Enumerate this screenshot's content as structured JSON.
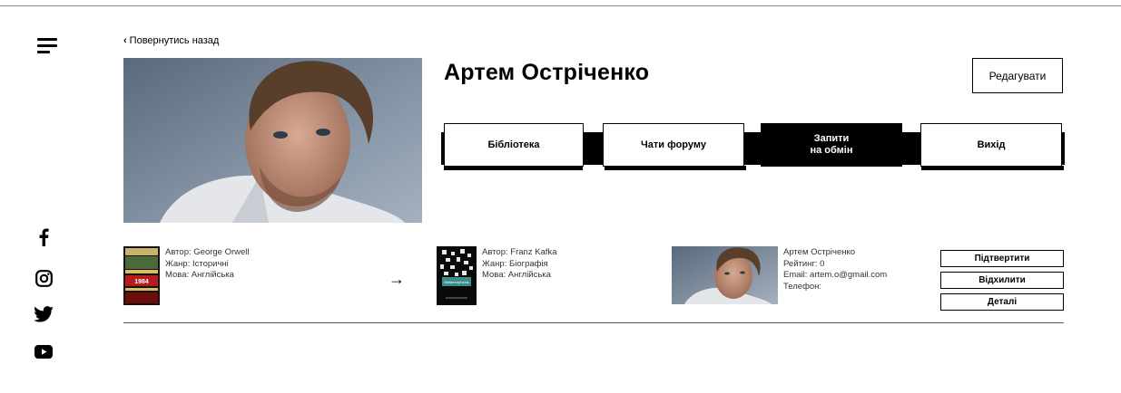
{
  "nav": {
    "back_label": "Повернутись назад",
    "menu_icon": "hamburger-icon"
  },
  "social": [
    "facebook-icon",
    "instagram-icon",
    "twitter-icon",
    "youtube-icon"
  ],
  "profile": {
    "name": "Артем Остріченко",
    "edit_label": "Редагувати",
    "photo": "profile-photo"
  },
  "tabs": [
    {
      "label": "Бібліотека",
      "active": false
    },
    {
      "label": "Чати форуму",
      "active": false
    },
    {
      "label": "Запити\nна обмін",
      "active": true
    },
    {
      "label": "Вихід",
      "active": false
    }
  ],
  "request": {
    "offered_book": {
      "author": "Автор: George Orwell",
      "genre": "Жанр: Історичні",
      "language": "Мова: Англійська",
      "cover_title": "1984"
    },
    "wanted_book": {
      "author": "Автор: Franz Kafka",
      "genre": "Жанр: Біографія",
      "language": "Мова: Англійська",
      "cover_title": "Metamorphosis"
    },
    "user": {
      "name": "Артем Остріченко",
      "rating": "Рейтинг: 0",
      "email": "Email: artem.o@gmail.com",
      "phone": "Телефон:"
    },
    "actions": {
      "confirm": "Підтвертити",
      "decline": "Відхилити",
      "details": "Деталі"
    }
  }
}
